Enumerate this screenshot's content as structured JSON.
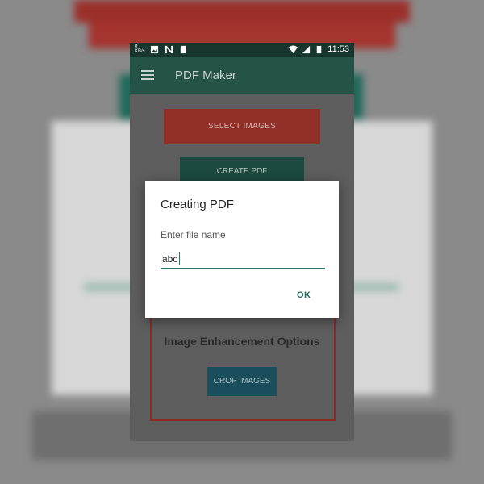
{
  "status_bar": {
    "data_rate": "0 KB/s",
    "time": "11:53"
  },
  "app_bar": {
    "title": "PDF Maker"
  },
  "main": {
    "select_images_label": "SELECT IMAGES",
    "create_pdf_label": "CREATE PDF",
    "enhancement_title": "Image Enhancement Options",
    "crop_images_label": "CROP IMAGES"
  },
  "dialog": {
    "title": "Creating PDF",
    "field_label": "Enter file name",
    "file_name_value": "abc",
    "ok_label": "OK"
  },
  "colors": {
    "accent": "#1f7a6a",
    "primary_dark": "#265348",
    "select_button": "#c0392b",
    "crop_button": "#1b6a80"
  }
}
